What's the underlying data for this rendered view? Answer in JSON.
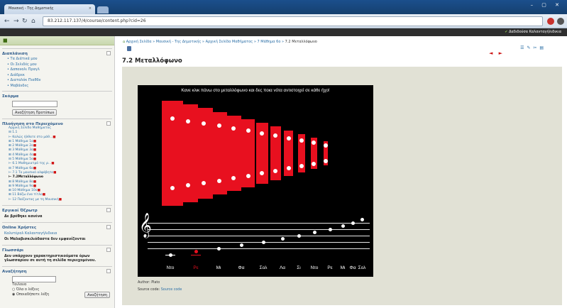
{
  "browser": {
    "tab_title": "Μουσική - Της Δημοτικής",
    "tab_close": "×",
    "url": "83.212.117.137/4/course/content.php?cid=26",
    "window_controls": "–  ▢  ✕",
    "nav_icons": [
      "arrow-left-icon",
      "arrow-right-icon",
      "reload-icon",
      "home-icon"
    ]
  },
  "topbar": {
    "user": "Δαδιδούσα Καλανταγήλιδικια"
  },
  "sidebar": {
    "top_icon": "■",
    "blocks": {
      "navigation": {
        "title": "Διαπλάνιση",
        "items": [
          "Τα Διάτικά μου",
          "Οι Σελιδές μου",
          "Δαπανολι Πραγλ",
          "Διάδρεκ",
          "Διαταλόκ Πιαθδν",
          "Μαβάνδες"
        ]
      },
      "search": {
        "title": "Σκόρμα",
        "button": "Αναζήτηση Προτύπων"
      },
      "tree": {
        "title": "Πλοήγηση στο Περιεχόμενο",
        "items": [
          {
            "label": "Αρχική Σελίδα Μαθήματος",
            "mark": ""
          },
          {
            "label": "⊟ 1.1",
            "mark": ""
          },
          {
            "label": "⊢ Καλώς ήλθατε στο μάθ...",
            "mark": "■"
          },
          {
            "label": "⊞ 1 Μάθημα 1ο",
            "mark": "■"
          },
          {
            "label": "⊞ 2 Μάθημα 2ο",
            "mark": "■"
          },
          {
            "label": "⊞ 3 Μάθημα 3ο",
            "mark": "■"
          },
          {
            "label": "⊞ 4 Μάθημα 4ο",
            "mark": "■"
          },
          {
            "label": "⊟ 5 Μάθημα 5ο",
            "mark": "■"
          },
          {
            "label": "⊢ 6.1 Μαθημιατρό της ρ...",
            "mark": "■"
          },
          {
            "label": "⊟ 7 Μάθημα 6ο",
            "mark": "■"
          },
          {
            "label": "⊢ 7.1 Το μουσικό αλφάβητο",
            "mark": "■"
          },
          {
            "label": "⊢ 7.2Μεταλλόφωνο",
            "mark": "",
            "current": true
          },
          {
            "label": "⊞ 8 Μάθημα 8ο",
            "mark": "■"
          },
          {
            "label": "⊞ 9 Μάθημα 9ο",
            "mark": "■"
          },
          {
            "label": "⊞ 10 Μάθημα 10ο",
            "mark": "■"
          },
          {
            "label": "⊞ 11 Βάζω ένα τίτλο",
            "mark": "■"
          },
          {
            "label": "⊢ 12 Παίζοντας με τη Μουσική",
            "mark": "■"
          }
        ]
      },
      "glossary": {
        "title": "Εργικοί Όζρωτρ",
        "text": "Δε βρέθηκε κανένα"
      },
      "online": {
        "title": "Online Χρήστες",
        "text1": "Καλυτέρολ Καλανταγήλιδικια",
        "text2": "Οι Μαλαβισκιλιόδαστα δεν εμφανίζονται"
      },
      "glossary2": {
        "title": "Γλωσσάρι",
        "text": "Δεν υπάρχουν χαρακτηριστικούματα όρων γλωσσαρίου σε αυτή τη σελίδα περιεχομένου."
      },
      "search2": {
        "title": "Αναζήτηση",
        "label": "Ταιλουα",
        "option1": "Όλα ο λέξεις",
        "option2": "Οποιαδήποτε λέξη",
        "button": "Αναζήτηση"
      }
    }
  },
  "main": {
    "breadcrumb": [
      "Αρχική Σελίδα",
      "Μουσική - Της Δημοτικής",
      "Αρχική Σελίδα Μαθήματος",
      "7 Μάθημα 6ο",
      "7.2 Μεταλλόφωνο"
    ],
    "page_title": "7.2 Μεταλλόφωνο",
    "edit_icons": "☰ ✎ ✂ ▤",
    "arrows": "◄ ►",
    "xylophone": {
      "instruction": "Κανε κλικ πάνω στο μεταλλόφωνο και δες ποια νότα αντιστοιχεί σε κάθε ήχο!",
      "notes": [
        "Ντο",
        "Ρε",
        "Μι",
        "Φα",
        "Σολ",
        "Λα",
        "Σι",
        "Ντο",
        "Ρε",
        "Μι",
        "Φα",
        "Σολ"
      ],
      "highlight_color": "#e8101f",
      "bar_color": "#e8101f",
      "clef": "𝄞"
    },
    "author": "Author: Plato",
    "source_prefix": "Source code:",
    "source_link": "Source code"
  }
}
